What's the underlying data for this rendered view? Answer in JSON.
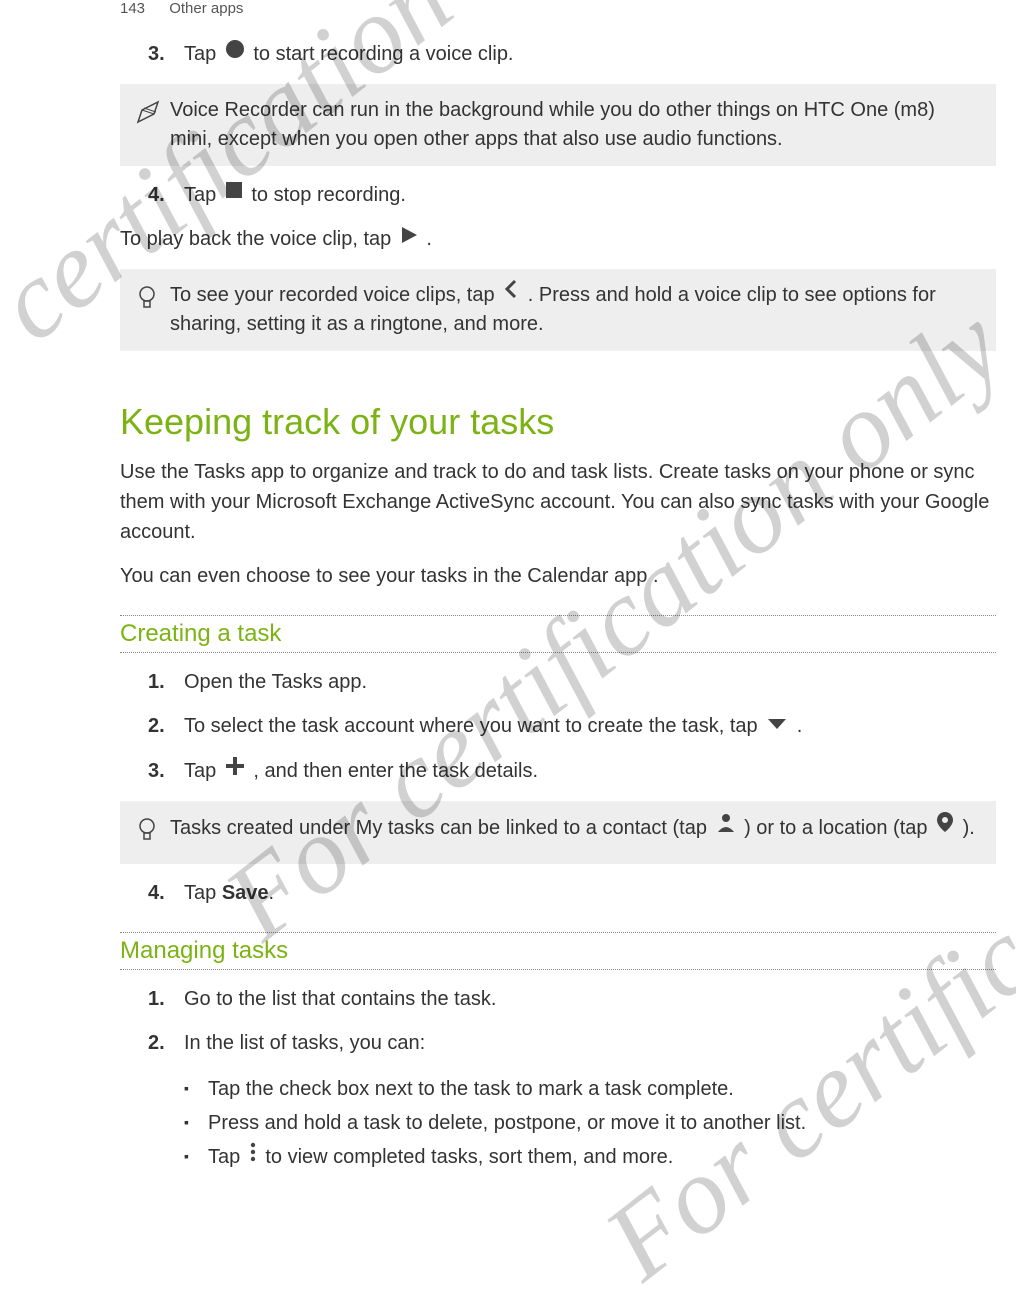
{
  "header": {
    "page_num": "143",
    "section": "Other apps"
  },
  "voice": {
    "step3_pre": "Tap ",
    "step3_post": " to start recording a voice clip.",
    "note1": "Voice Recorder can run in the background while you do other things on HTC One (m8) mini, except when you open other apps that also use audio functions.",
    "step4_pre": "Tap ",
    "step4_post": " to stop recording.",
    "playback_pre": "To play back the voice clip, tap ",
    "playback_post": ".",
    "note2_pre": "To see your recorded voice clips, tap ",
    "note2_post": ". Press and hold a voice clip to see options for sharing, setting it as a ringtone, and more."
  },
  "tasks": {
    "heading": "Keeping track of your tasks",
    "intro1": "Use the Tasks app to organize and track to do and task lists. Create tasks on your phone or sync them with your Microsoft Exchange ActiveSync account. You can also sync tasks with your Google account.",
    "intro2": "You can even choose to see your tasks in the Calendar app .",
    "creating": {
      "title": "Creating a task",
      "s1": "Open the Tasks app.",
      "s2_pre": "To select the task account where you want to create the task, tap ",
      "s2_post": " .",
      "s3_pre": "Tap ",
      "s3_post": ", and then enter the task details.",
      "tip_pre": "Tasks created under My tasks can be linked to a contact (tap ",
      "tip_mid": ") or to a location (tap ",
      "tip_post": ").",
      "s4_pre": "Tap ",
      "s4_bold": "Save",
      "s4_post": "."
    },
    "managing": {
      "title": "Managing tasks",
      "s1": "Go to the list that contains the task.",
      "s2": "In the list of tasks, you can:",
      "b1": "Tap the check box next to the task to mark a task complete.",
      "b2": "Press and hold a task to delete, postpone, or move it to another list.",
      "b3_pre": "Tap ",
      "b3_post": " to view completed tasks, sort them, and more."
    }
  },
  "watermark": "For certification only"
}
